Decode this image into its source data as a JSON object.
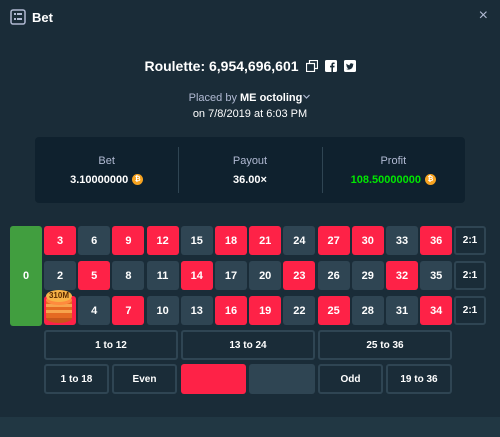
{
  "header": {
    "title": "Bet",
    "close_glyph": "×",
    "icon": "bet-slip-icon"
  },
  "game": {
    "title": "Roulette: 6,954,696,601",
    "icons": [
      "copy-icon",
      "facebook-icon",
      "twitter-icon"
    ]
  },
  "placed": {
    "prefix": "Placed by",
    "user": "ME octoling",
    "date": "on 7/8/2019 at 6:03 PM"
  },
  "stats": {
    "bet_label": "Bet",
    "bet_value": "3.10000000",
    "payout_label": "Payout",
    "payout_value": "36.00×",
    "profit_label": "Profit",
    "profit_value": "108.50000000",
    "coin_glyph": "₿"
  },
  "board": {
    "zero": "0",
    "rows": [
      [
        "3",
        "6",
        "9",
        "12",
        "15",
        "18",
        "21",
        "24",
        "27",
        "30",
        "33",
        "36"
      ],
      [
        "2",
        "5",
        "8",
        "11",
        "14",
        "17",
        "20",
        "23",
        "26",
        "29",
        "32",
        "35"
      ],
      [
        "1",
        "4",
        "7",
        "10",
        "13",
        "16",
        "19",
        "22",
        "25",
        "28",
        "31",
        "34"
      ]
    ],
    "red_numbers": [
      "1",
      "3",
      "5",
      "7",
      "9",
      "12",
      "14",
      "16",
      "18",
      "19",
      "21",
      "23",
      "25",
      "27",
      "30",
      "32",
      "34",
      "36"
    ],
    "column_bets": [
      "2:1",
      "2:1",
      "2:1"
    ],
    "dozens": [
      "1 to 12",
      "13 to 24",
      "25 to 36"
    ],
    "outside": {
      "low": "1 to 18",
      "even": "Even",
      "odd": "Odd",
      "high": "19 to 36"
    },
    "chip": {
      "label": "310M",
      "on_number": "1"
    }
  },
  "colors": {
    "red": "#fe2247",
    "black": "#2f4553",
    "green": "#419e3f",
    "profit": "#00e701",
    "bg": "#1a2c38",
    "panel": "#0f212e"
  }
}
